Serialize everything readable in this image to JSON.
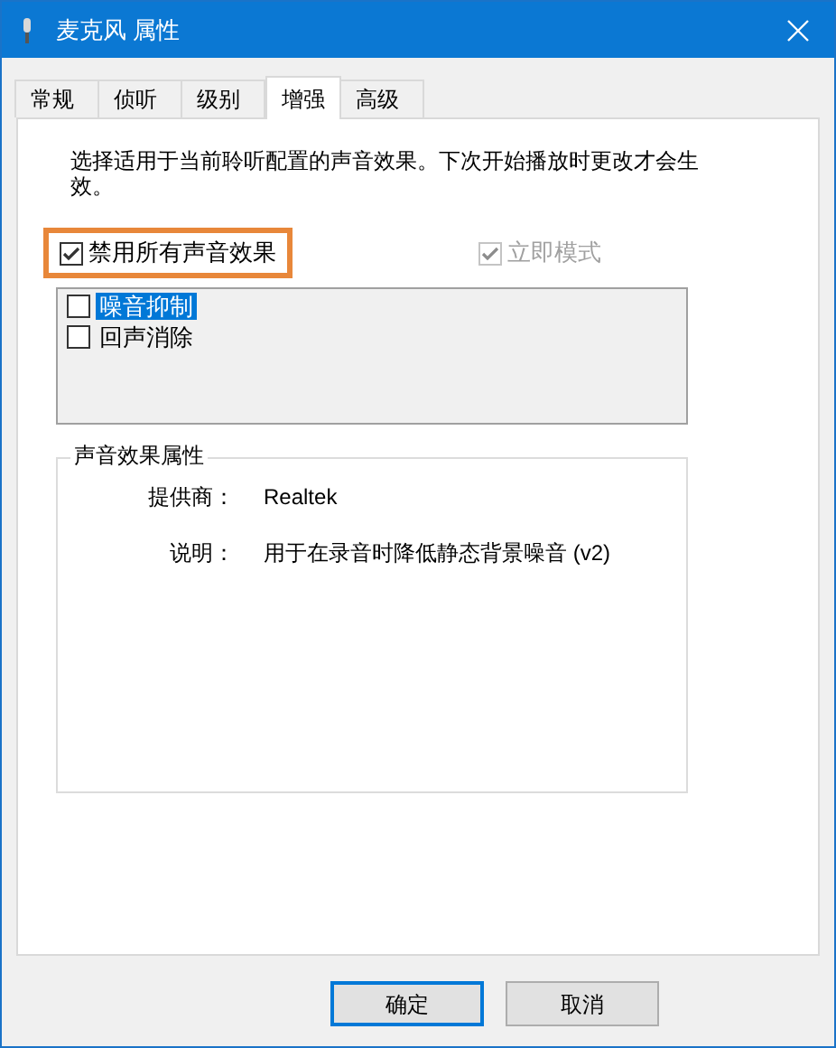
{
  "window": {
    "title": "麦克风 属性"
  },
  "tabs": [
    {
      "label": "常规",
      "selected": false
    },
    {
      "label": "侦听",
      "selected": false
    },
    {
      "label": "级别",
      "selected": false
    },
    {
      "label": "增强",
      "selected": true
    },
    {
      "label": "高级",
      "selected": false
    }
  ],
  "description": "选择适用于当前聆听配置的声音效果。下次开始播放时更改才会生效。",
  "disable_all": {
    "label": "禁用所有声音效果",
    "checked": true,
    "highlighted": true
  },
  "immediate_mode": {
    "label": "立即模式",
    "checked": true,
    "disabled": true
  },
  "effects": [
    {
      "label": "噪音抑制",
      "checked": false,
      "selected": true
    },
    {
      "label": "回声消除",
      "checked": false,
      "selected": false
    }
  ],
  "properties": {
    "title": "声音效果属性",
    "rows": [
      {
        "label": "提供商：",
        "value": "Realtek"
      },
      {
        "label": "说明：",
        "value": "用于在录音时降低静态背景噪音 (v2)"
      }
    ]
  },
  "buttons": [
    {
      "label": "确定",
      "default": true
    },
    {
      "label": "取消",
      "default": false
    }
  ]
}
